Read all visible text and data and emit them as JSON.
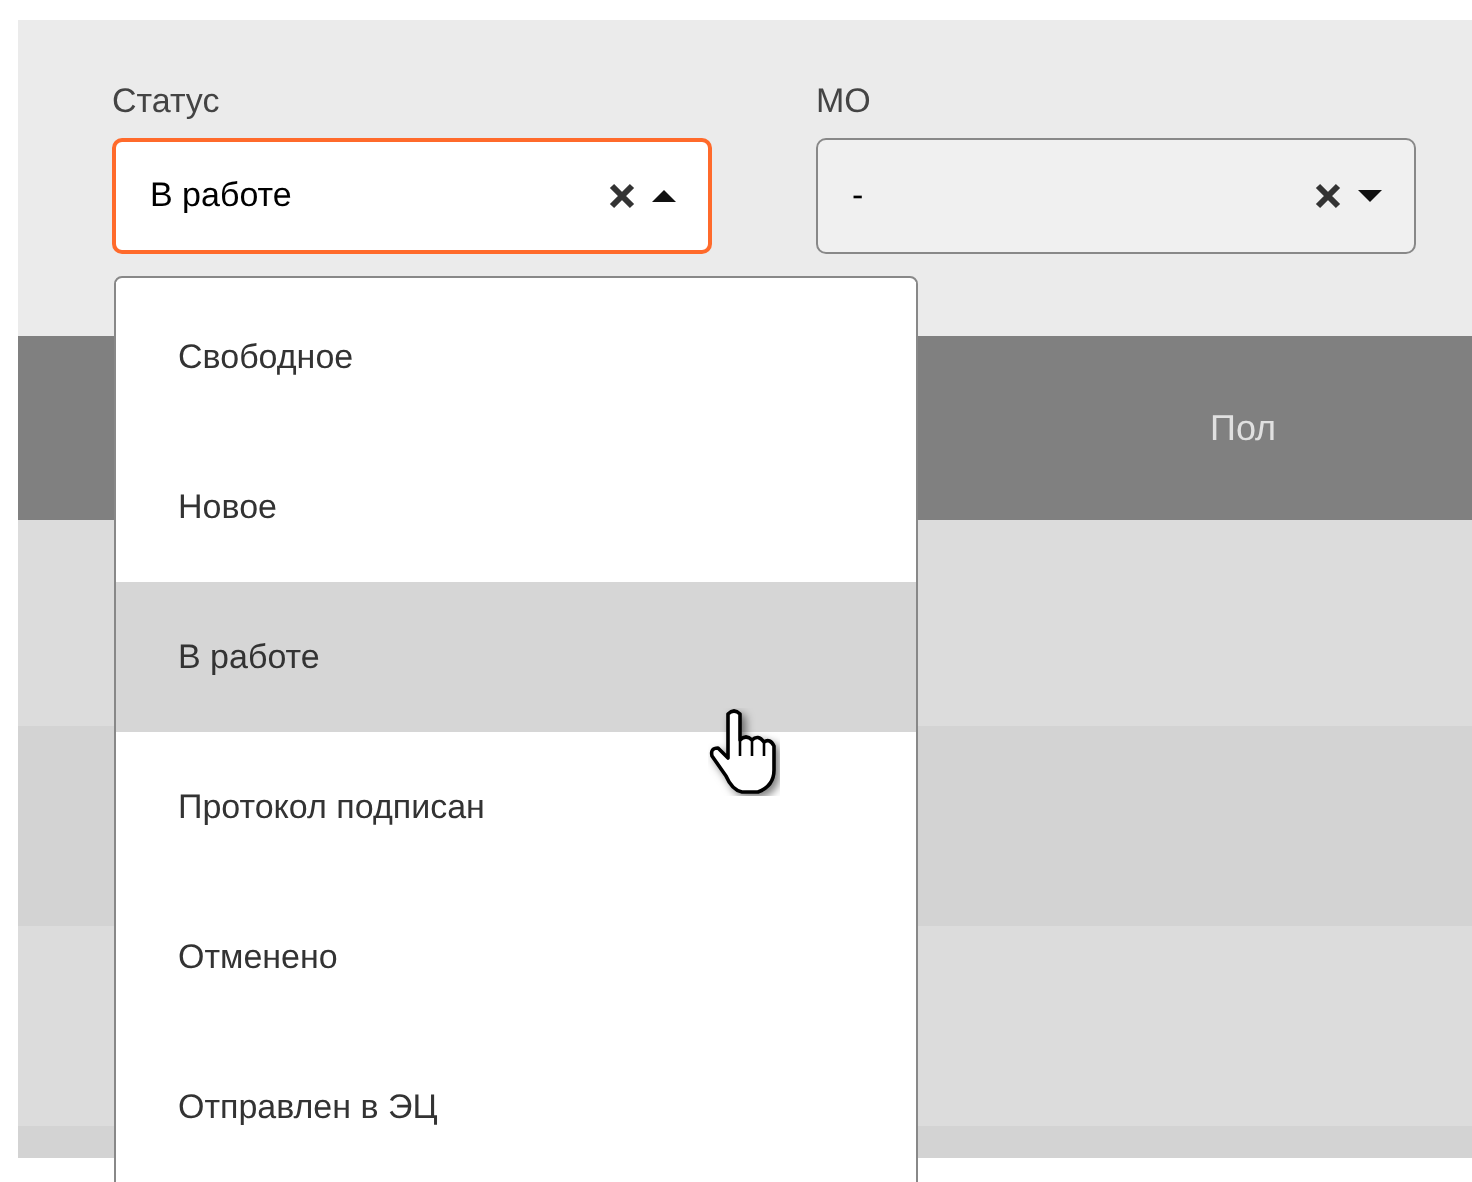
{
  "filters": [
    {
      "label": "Статус",
      "value": "В работе",
      "open": true
    },
    {
      "label": "МО",
      "value": "-",
      "open": false
    }
  ],
  "dropdown": {
    "options": [
      {
        "label": "Свободное",
        "selected": false
      },
      {
        "label": "Новое",
        "selected": false
      },
      {
        "label": "В работе",
        "selected": true
      },
      {
        "label": "Протокол подписан",
        "selected": false
      },
      {
        "label": "Отменено",
        "selected": false
      },
      {
        "label": "Отправлен в ЭЦ",
        "selected": false
      }
    ]
  },
  "table": {
    "columns": [
      "Пол"
    ]
  }
}
